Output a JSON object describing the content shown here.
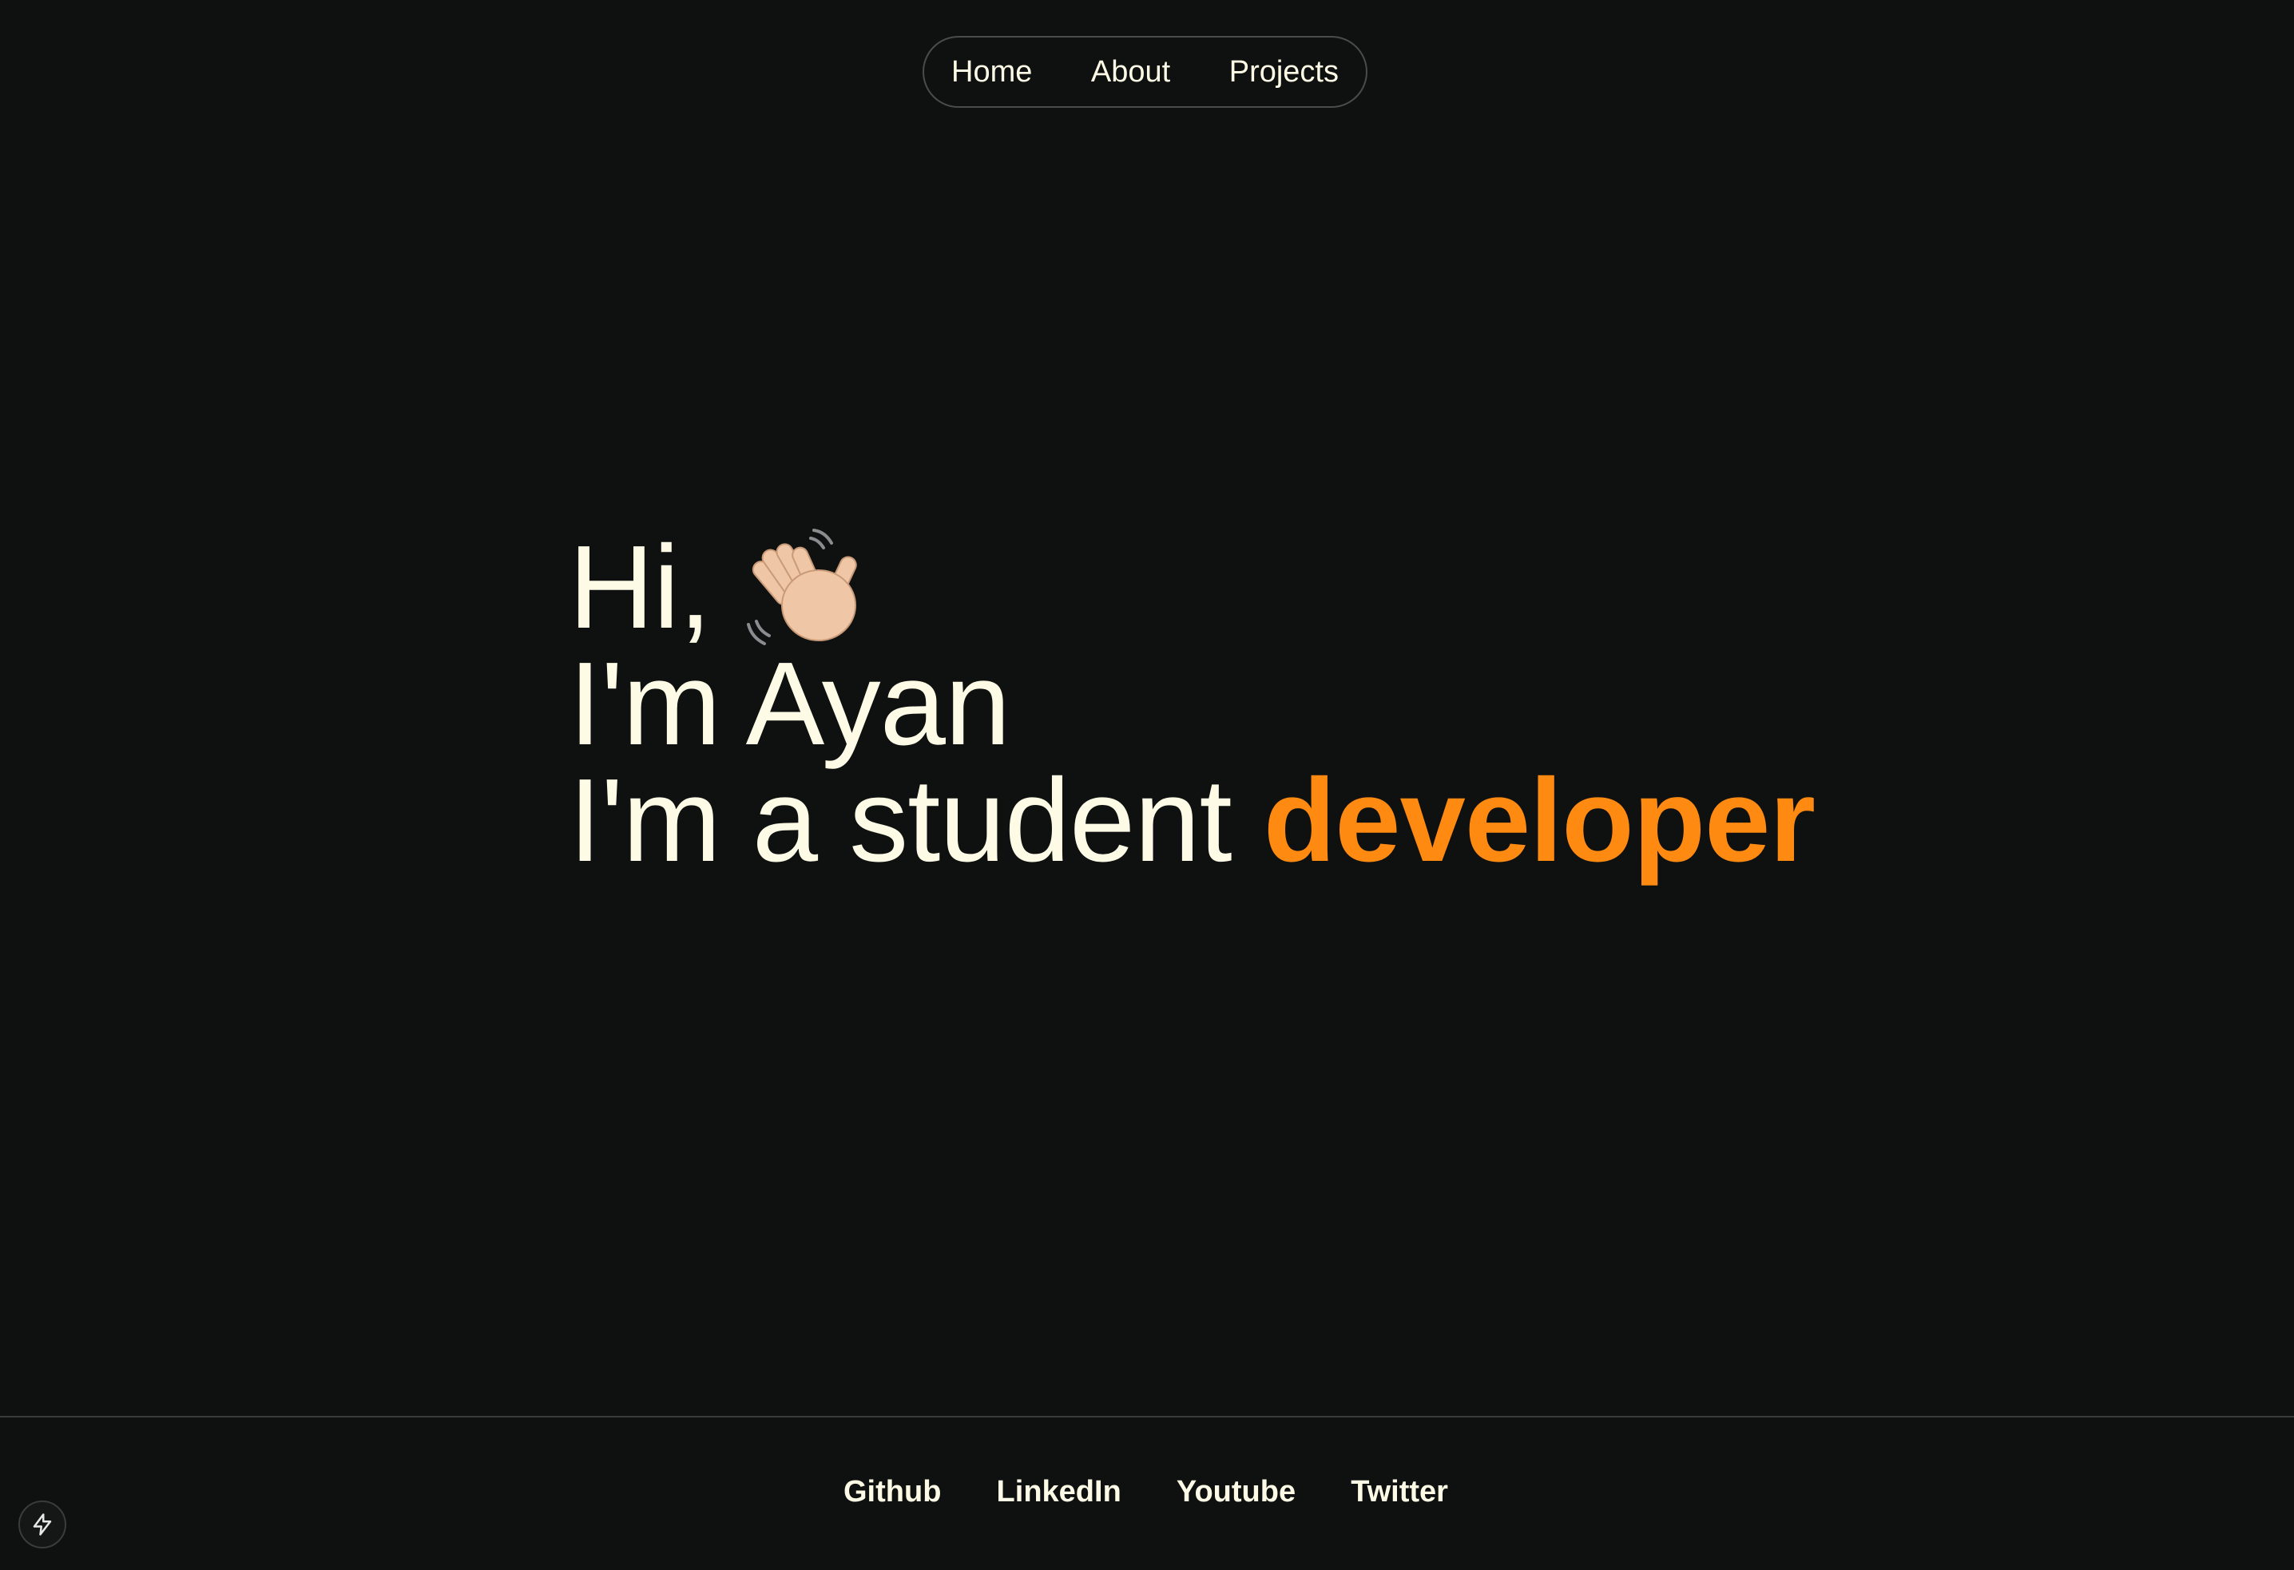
{
  "nav": {
    "items": [
      {
        "label": "Home"
      },
      {
        "label": "About"
      },
      {
        "label": "Projects"
      }
    ]
  },
  "hero": {
    "line1": "Hi,",
    "line2": "I'm Ayan",
    "line3_prefix": "I'm a student ",
    "line3_accent": "developer",
    "accent_color": "#ff8a12",
    "text_color": "#fdfbe6",
    "icon": "waving-hand-icon"
  },
  "footer": {
    "links": [
      {
        "label": "Github"
      },
      {
        "label": "LinkedIn"
      },
      {
        "label": "Youtube"
      },
      {
        "label": "Twitter"
      }
    ]
  },
  "badge": {
    "icon": "lightning-bolt-icon"
  },
  "colors": {
    "background": "#0f1110",
    "border": "#4a4c4b"
  }
}
